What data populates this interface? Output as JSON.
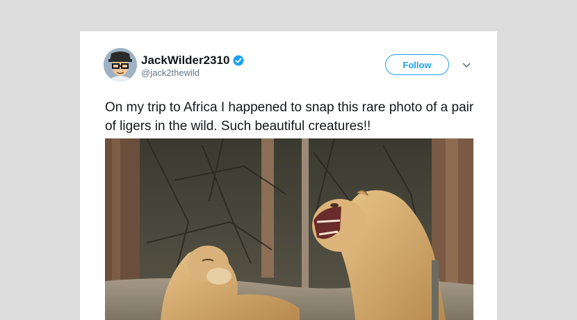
{
  "tweet": {
    "display_name": "JackWilder2310",
    "handle": "@jack2thewild",
    "follow_label": "Follow",
    "text": "On my trip to Africa I happened to snap this rare photo of a pair of ligers in the wild. Such beautiful creatures!!"
  },
  "icons": {
    "verified": "verified-badge-icon",
    "caret": "chevron-down-icon",
    "avatar": "avatar"
  },
  "colors": {
    "accent": "#1da1f2",
    "text": "#14171a",
    "muted": "#657786",
    "background": "#dcdcdc",
    "card": "#ffffff"
  }
}
